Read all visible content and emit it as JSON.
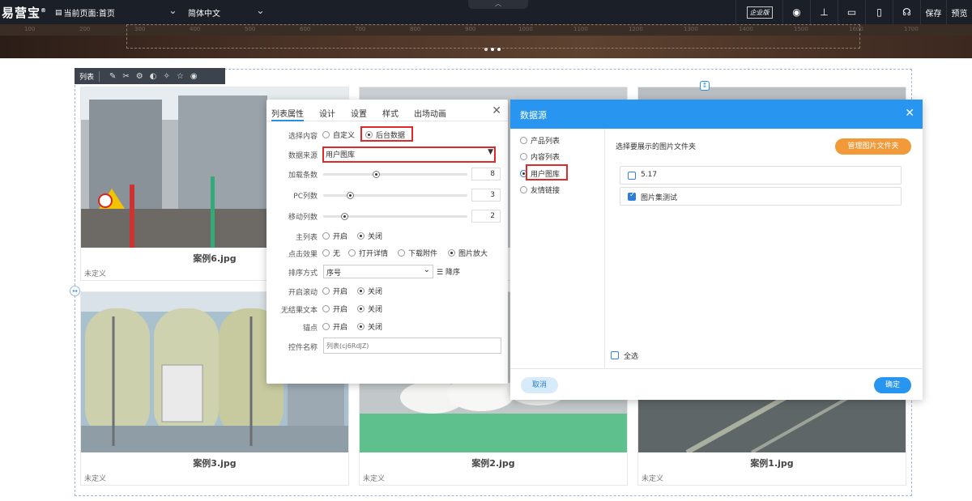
{
  "topbar": {
    "logo": "易营宝",
    "logo_mark": "®",
    "current_page": "当前页面:首页",
    "language": "简体中文",
    "enterprise_badge": "企业版",
    "save_label": "保存",
    "preview_label": "预览"
  },
  "ruler": {
    "ticks": [
      "100",
      "200",
      "300",
      "400",
      "500",
      "600",
      "700",
      "800",
      "900",
      "1000",
      "1100",
      "1200",
      "1300",
      "1400",
      "1500",
      "1600",
      "1700"
    ]
  },
  "list_toolbar": {
    "label": "列表"
  },
  "cards": [
    {
      "caption": "案例6.jpg",
      "desc": "未定义"
    },
    {
      "caption": "案例3.jpg",
      "desc": "未定义"
    },
    {
      "caption": "案例2.jpg",
      "desc": "未定义"
    },
    {
      "caption": "案例1.jpg",
      "desc": "未定义"
    }
  ],
  "props_panel": {
    "tabs": [
      "列表属性",
      "设计",
      "设置",
      "样式",
      "出场动画"
    ],
    "content_label": "选择内容",
    "content_options": [
      "自定义",
      "后台数据"
    ],
    "source_label": "数据来源",
    "source_value": "用户图库",
    "load_count_label": "加载条数",
    "load_count": "8",
    "load_count_value": 8,
    "pc_cols_label": "PC列数",
    "pc_cols": "3",
    "pc_cols_value": 3,
    "mobile_cols_label": "移动列数",
    "mobile_cols": "2",
    "mobile_cols_value": 2,
    "main_list_label": "主列表",
    "open": "开启",
    "close": "关闭",
    "click_effect_label": "点击效果",
    "click_options": [
      "无",
      "打开详情",
      "下载附件",
      "图片放大"
    ],
    "sort_label": "排序方式",
    "sort_value": "序号",
    "sort_order": "降序",
    "scroll_label": "开启滚动",
    "noresult_label": "无结果文本",
    "anchor_label": "锚点",
    "name_label": "控件名称",
    "name_placeholder": "列表(cj6RdJZ)"
  },
  "datasource_dialog": {
    "title": "数据源",
    "options": [
      "产品列表",
      "内容列表",
      "用户图库",
      "友情链接"
    ],
    "selected": "用户图库",
    "prompt": "选择要展示的图片文件夹",
    "manage_button": "管理图片文件夹",
    "folders": [
      {
        "name": "5.17",
        "checked": false
      },
      {
        "name": "图片集测试",
        "checked": true
      }
    ],
    "select_all": "全选",
    "cancel": "取消",
    "confirm": "确定"
  },
  "colors": {
    "topbar": "#1b1f27",
    "accent_blue": "#2896f0",
    "manage_orange": "#f29a3a",
    "highlight_red": "#e02a2a"
  }
}
